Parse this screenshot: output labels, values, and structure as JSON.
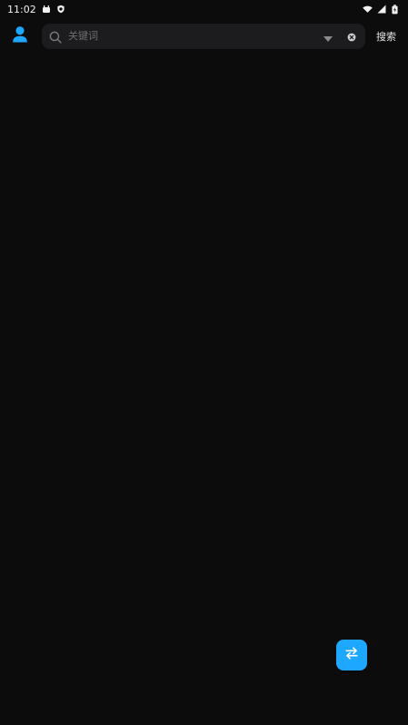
{
  "status_bar": {
    "time": "11:02"
  },
  "header": {
    "avatar_icon": "person-icon",
    "search": {
      "placeholder": "关键词",
      "value": ""
    },
    "search_button_label": "搜索"
  },
  "colors": {
    "accent": "#1ea7ff",
    "background": "#0c0c0d",
    "search_bg": "#1c1c1e"
  },
  "fab": {
    "icon": "swap-arrows-icon"
  }
}
